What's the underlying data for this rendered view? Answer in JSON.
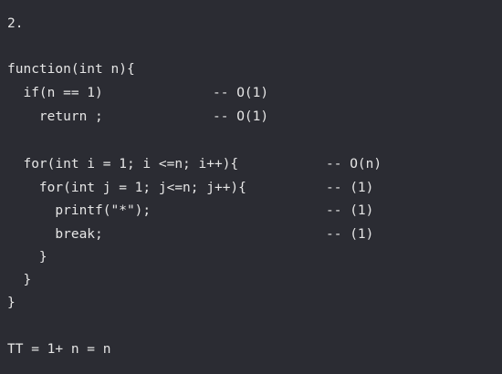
{
  "lines": [
    "2.",
    "",
    "function(int n){",
    "  if(n == 1)",
    "    return ;",
    "",
    "  for(int i = 1; i <=n; i++){",
    "    for(int j = 1; j<=n; j++){",
    "      printf(\"*\");",
    "      break;",
    "    }",
    "  }",
    "}",
    "",
    "TT = 1+ n = n"
  ],
  "comments": [
    {
      "line": 3,
      "text": "-- O(1)"
    },
    {
      "line": 4,
      "text": "-- O(1)"
    },
    {
      "line": 6,
      "text": "-- O(n)"
    },
    {
      "line": 7,
      "text": "-- (1)"
    },
    {
      "line": 8,
      "text": "-- (1)"
    },
    {
      "line": 9,
      "text": "-- (1)"
    }
  ],
  "colors": {
    "background": "#2b2c33",
    "text": "#e6e6e6"
  }
}
